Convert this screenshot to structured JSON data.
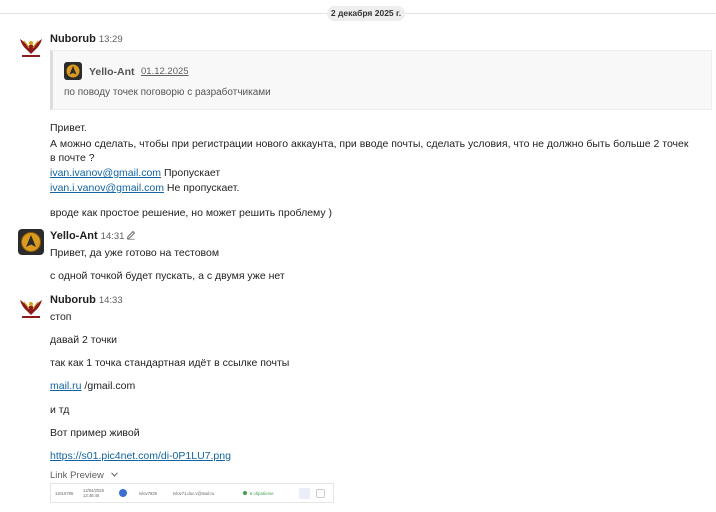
{
  "date_separator": "2 декабря 2025 г.",
  "messages": [
    {
      "author": "Nuborub",
      "time": "13:29",
      "quote": {
        "author": "Yello-Ant",
        "date": "01.12.2025",
        "text": "по поводу точек поговорю с разработчиками"
      },
      "lines": [
        "Привет.",
        "А можно сделать, чтобы при регистрации нового аккаунта, при вводе почты, сделать условия, что не должно быть больше 2 точек",
        "в почте ?",
        {
          "link": "ivan.ivanov@gmail.com",
          "suffix": " Пропускает"
        },
        {
          "link": "ivan.i.vanov@gmail.com",
          "suffix": " Не пропускает."
        },
        "вроде как простое решение, но может решить проблему )"
      ]
    },
    {
      "author": "Yello-Ant",
      "time": "14:31",
      "edited_icon": "pencil-icon",
      "lines": [
        "Привет, да уже готово на тестовом",
        "с одной точкой будет пускать, а с двумя уже нет"
      ]
    },
    {
      "author": "Nuborub",
      "time": "14:33",
      "lines": [
        "стоп",
        "давай 2 точки",
        "так как 1 точка стандартная идёт в ссылке почты",
        {
          "link": "mail.ru",
          "suffix": " /gmail.com"
        },
        "и тд",
        "Вот пример живой",
        {
          "link": "https://s01.pic4net.com/di-0P1LU7.png",
          "suffix": ""
        }
      ],
      "link_preview": {
        "label": "Link Preview",
        "toggle_icon": "chevron-down-icon",
        "image_cells": [
          "11816785",
          "12/04/2025 13:48:46",
          "Ivlov7839",
          "Ivlov71.duc.v@mail.ru",
          "в обработке"
        ]
      }
    }
  ],
  "colors": {
    "link": "#1264a3",
    "text": "#1f1f1f",
    "muted": "#616061",
    "separator_bg": "#eeeeee",
    "nuborub_avatar": "#8b1a1a",
    "yelloant_avatar": "#d99a1f"
  }
}
